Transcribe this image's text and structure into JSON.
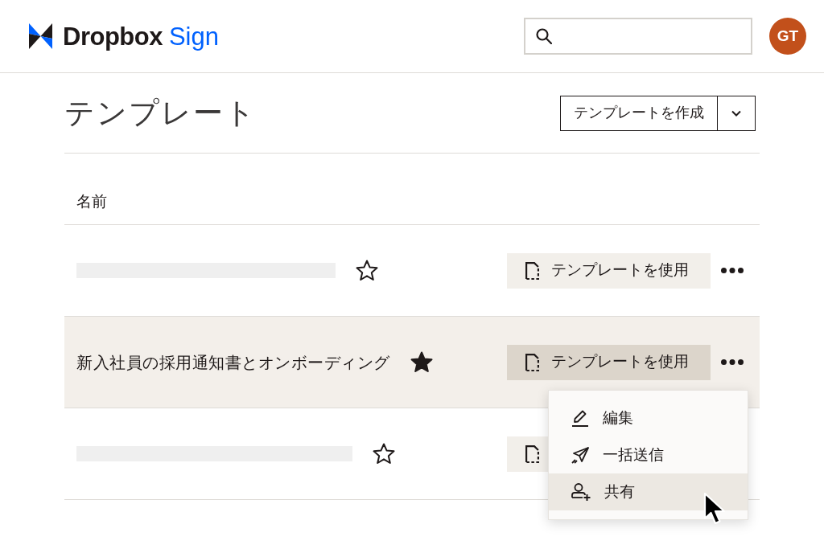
{
  "header": {
    "logo": {
      "wordmark": "Dropbox",
      "product": "Sign"
    },
    "avatar": {
      "initials": "GT"
    }
  },
  "page": {
    "title": "テンプレート",
    "create_button": {
      "label": "テンプレートを作成"
    }
  },
  "table": {
    "columns": [
      "名前"
    ],
    "rows": [
      {
        "kind": "placeholder",
        "starred": false,
        "highlighted": false,
        "action_label": "テンプレートを使用"
      },
      {
        "kind": "named",
        "name": "新入社員の採用通知書とオンボーディング",
        "starred": true,
        "highlighted": true,
        "action_label": "テンプレートを使用"
      },
      {
        "kind": "placeholder",
        "starred": false,
        "highlighted": false
      }
    ]
  },
  "menu": {
    "items": [
      {
        "kind": "edit",
        "label": "編集",
        "selected": false
      },
      {
        "kind": "bulk_send",
        "label": "一括送信",
        "selected": false
      },
      {
        "kind": "share",
        "label": "共有",
        "selected": true
      }
    ]
  }
}
